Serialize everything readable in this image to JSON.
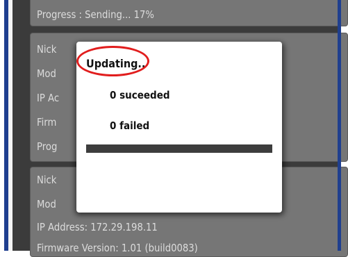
{
  "device_list": {
    "card1": {
      "progress": "Progress : Sending... 17%"
    },
    "card2": {
      "nickname": "Nick",
      "model": "Mod",
      "ip_address": "IP Ac",
      "firmware": "Firm",
      "progress": "Prog"
    },
    "card3": {
      "nickname": "Nick",
      "model": "Mod",
      "ip_address": "IP Address: 172.29.198.11",
      "firmware": "Firmware Version: 1.01 (build0083)"
    }
  },
  "dialog": {
    "title": "Updating..",
    "succeeded": "0 suceeded",
    "failed": "0 failed",
    "progress_fraction": 1.0
  },
  "colors": {
    "accent_blue": "#1f3f8f",
    "annotation_red": "#e11d1d",
    "card_gray": "#767676"
  }
}
